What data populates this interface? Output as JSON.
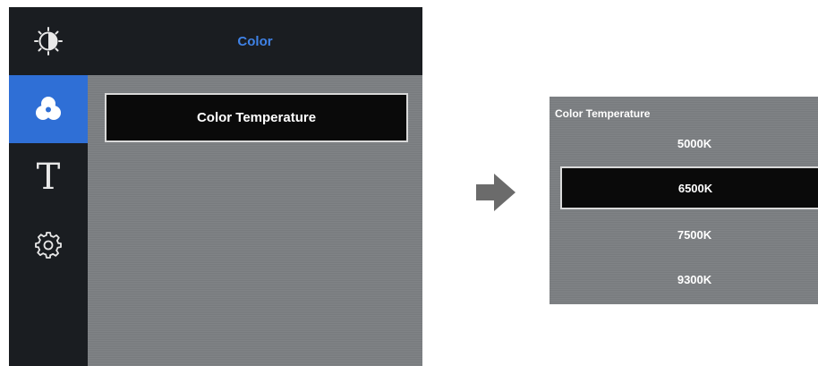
{
  "sidebar": {
    "items": [
      {
        "icon": "brightness-icon",
        "active": false
      },
      {
        "icon": "color-icon",
        "active": true
      },
      {
        "icon": "text-icon",
        "glyph": "T",
        "active": false
      },
      {
        "icon": "gear-icon",
        "active": false
      }
    ]
  },
  "menu": {
    "title": "Color",
    "items": [
      {
        "label": "Color Temperature",
        "selected": true
      }
    ]
  },
  "submenu": {
    "title": "Color Temperature",
    "options": [
      {
        "label": "5000K",
        "selected": false
      },
      {
        "label": "6500K",
        "selected": true
      },
      {
        "label": "7500K",
        "selected": false
      },
      {
        "label": "9300K",
        "selected": false
      }
    ]
  },
  "colors": {
    "accent_blue": "#2f6fd6",
    "title_blue": "#3f82e6",
    "panel_gray": "#7c7f82",
    "sidebar_dark": "#1a1d21",
    "selected_bg": "#0a0a0a"
  }
}
